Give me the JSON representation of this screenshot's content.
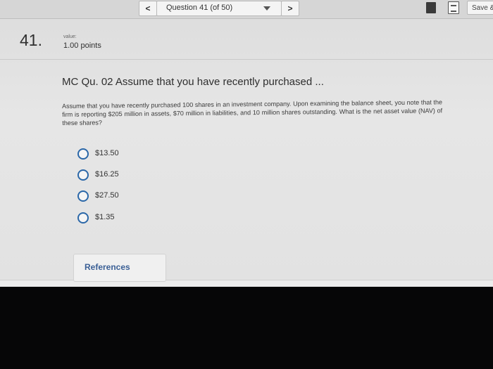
{
  "toolbar": {
    "prev_label": "<",
    "next_label": ">",
    "question_selector": "Question 41 (of 50)",
    "save_label": "Save &"
  },
  "question": {
    "number": "41.",
    "value_label": "value:",
    "points": "1.00 points",
    "title": "MC Qu. 02 Assume that you have recently purchased ...",
    "body": "Assume that you have recently purchased 100 shares in an investment company. Upon examining the balance sheet, you note that the firm is reporting $205 million in assets, $70 million in liabilities, and 10 million shares outstanding. What is the net asset value (NAV) of these shares?",
    "options": [
      {
        "label": "$13.50"
      },
      {
        "label": "$16.25"
      },
      {
        "label": "$27.50"
      },
      {
        "label": "$1.35"
      }
    ]
  },
  "references_label": "References",
  "icons": {
    "toolbar_tool_1": "book-icon",
    "toolbar_tool_2": "calculator-icon",
    "option_control": "radio-icon"
  },
  "colors": {
    "radio_border": "#2a67a8",
    "references_text": "#3a5f95"
  }
}
